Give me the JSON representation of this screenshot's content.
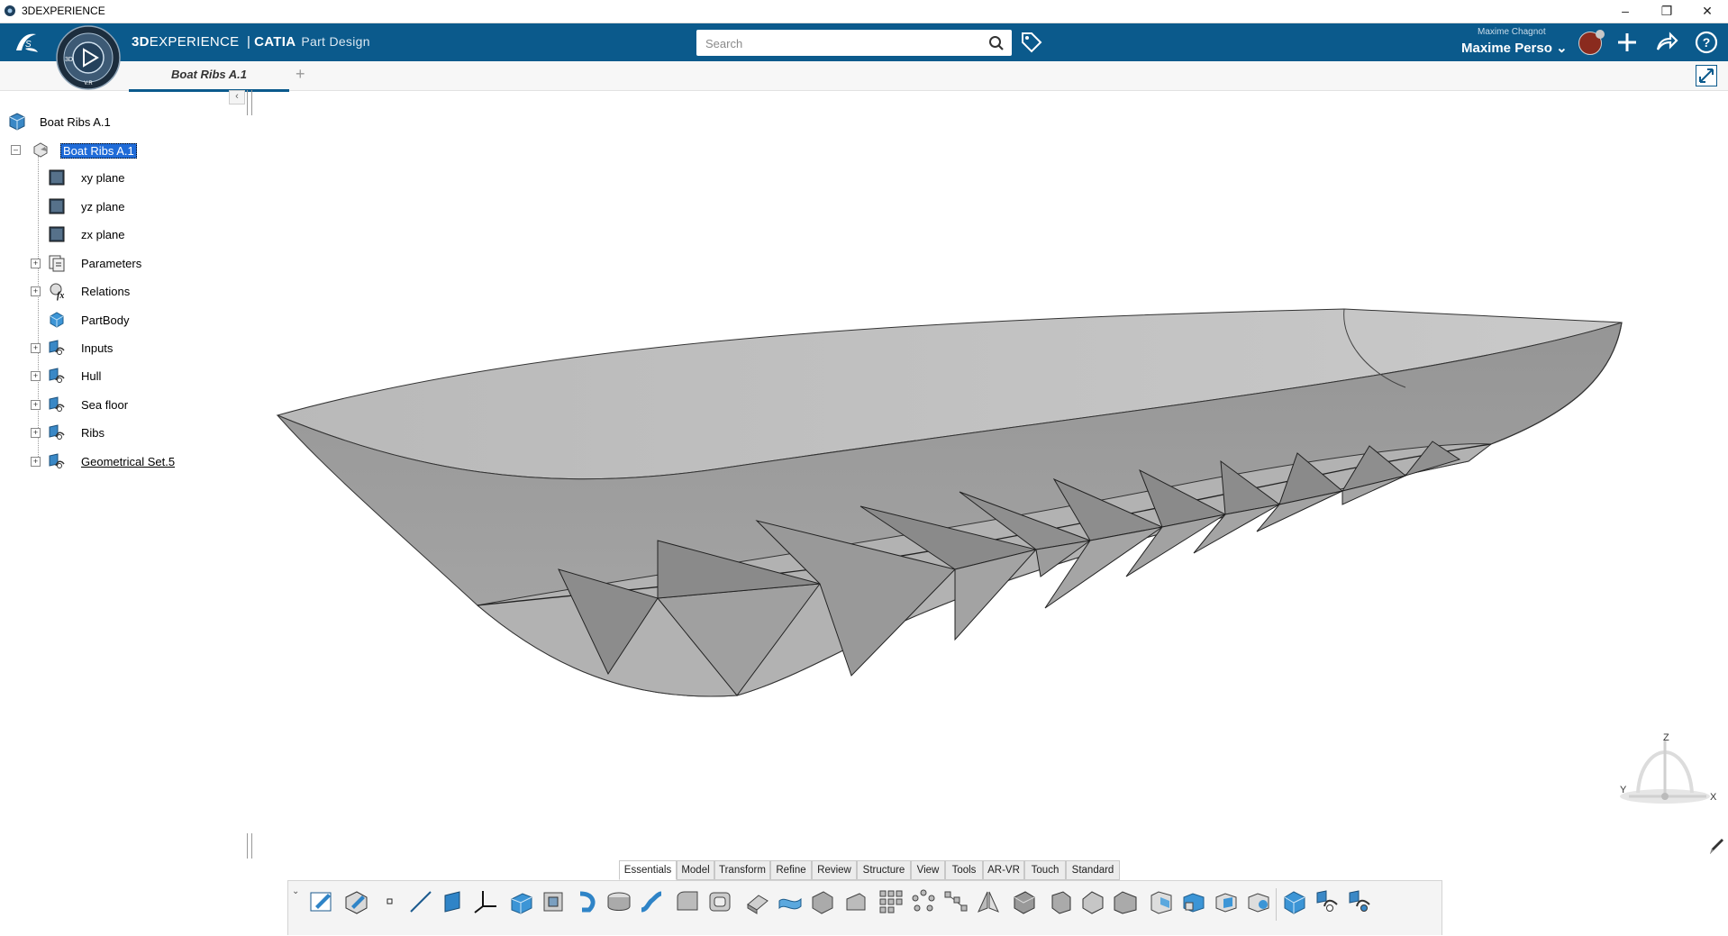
{
  "window": {
    "title": "3DEXPERIENCE",
    "minimize": "–",
    "restore": "❐",
    "close": "✕"
  },
  "topbar": {
    "brand_prefix": "3D",
    "brand_main": "EXPERIENCE",
    "brand_sep": "|",
    "brand_app": "CATIA",
    "brand_role": "Part Design",
    "search_placeholder": "Search",
    "user_top": "Maxime Chagnot",
    "user_name": "Maxime Perso",
    "user_chevron": "⌄",
    "compass_label_3d": "3D",
    "compass_label_vr": "V.R",
    "icons": [
      "search-icon",
      "tag-icon",
      "add-icon",
      "share-icon",
      "help-icon"
    ]
  },
  "tabs": {
    "active": "Boat Ribs A.1",
    "add": "+"
  },
  "tree": {
    "collapse": "‹",
    "root": "Boat Ribs A.1",
    "part": "Boat Ribs A.1",
    "items": [
      {
        "label": "xy plane",
        "icon": "plane-icon",
        "expandable": false
      },
      {
        "label": "yz plane",
        "icon": "plane-icon",
        "expandable": false
      },
      {
        "label": "zx plane",
        "icon": "plane-icon",
        "expandable": false
      },
      {
        "label": "Parameters",
        "icon": "parameters-icon",
        "expandable": true
      },
      {
        "label": "Relations",
        "icon": "relations-icon",
        "expandable": true
      },
      {
        "label": "PartBody",
        "icon": "partbody-icon",
        "expandable": false
      },
      {
        "label": "Inputs",
        "icon": "geometrical-set-icon",
        "expandable": true
      },
      {
        "label": "Hull",
        "icon": "geometrical-set-icon",
        "expandable": true
      },
      {
        "label": "Sea floor",
        "icon": "geometrical-set-icon",
        "expandable": true
      },
      {
        "label": "Ribs",
        "icon": "geometrical-set-icon",
        "expandable": true
      },
      {
        "label": "Geometrical Set.5",
        "icon": "geometrical-set-icon",
        "expandable": true
      }
    ]
  },
  "axis": {
    "x": "X",
    "y": "Y",
    "z": "Z"
  },
  "action_bar": {
    "sections": [
      "Essentials",
      "Model",
      "Transform",
      "Refine",
      "Review",
      "Structure",
      "View",
      "Tools",
      "AR-VR",
      "Touch",
      "Standard"
    ],
    "active_section": "Essentials",
    "collapse": "⌄",
    "tools": [
      "sketch-icon",
      "positioned-sketch-icon",
      "point-icon",
      "line-icon",
      "plane-icon",
      "axis-system-icon",
      "pad-icon",
      "pocket-icon",
      "rib-icon",
      "shaft-icon",
      "sweep-icon",
      "edge-fillet-icon",
      "shell-icon",
      "thickness-icon",
      "extrude-surface-icon",
      "offset-surface-icon",
      "fill-surface-icon",
      "pattern-icon",
      "circular-pattern-icon",
      "curve-pattern-icon",
      "mirror-icon",
      "split-icon",
      "thick-surface-icon",
      "close-surface-icon",
      "chamfer-icon",
      "draft-icon",
      "boolean-add-icon",
      "boolean-remove-icon",
      "boolean-intersect-icon",
      "boolean-union-trim-icon",
      "body-icon",
      "geometrical-set-insert-icon",
      "ordered-set-icon"
    ]
  }
}
